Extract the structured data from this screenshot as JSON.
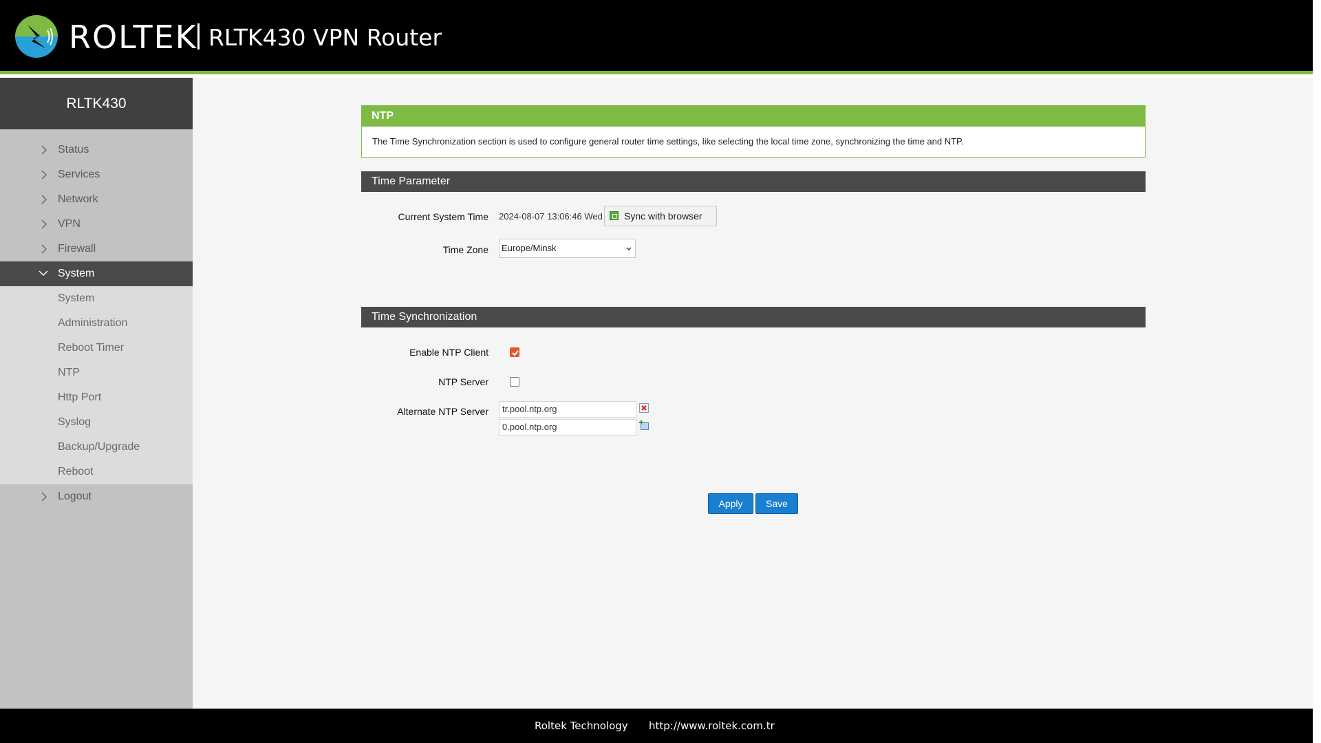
{
  "header": {
    "brand": "ROLTEK",
    "product": "RLTK430 VPN Router"
  },
  "sidebar": {
    "title": "RLTK430",
    "items": [
      {
        "label": "Status"
      },
      {
        "label": "Services"
      },
      {
        "label": "Network"
      },
      {
        "label": "VPN"
      },
      {
        "label": "Firewall"
      },
      {
        "label": "System"
      }
    ],
    "system_sub": [
      {
        "label": "System"
      },
      {
        "label": "Administration"
      },
      {
        "label": "Reboot Timer"
      },
      {
        "label": "NTP"
      },
      {
        "label": "Http Port"
      },
      {
        "label": "Syslog"
      },
      {
        "label": "Backup/Upgrade"
      },
      {
        "label": "Reboot"
      }
    ],
    "logout": "Logout"
  },
  "ntp_panel": {
    "title": "NTP",
    "description": "The Time Synchronization section is used to configure general router time settings, like selecting the local time zone, synchronizing the time and NTP."
  },
  "time_parameter": {
    "title": "Time Parameter",
    "current_time_label": "Current System Time",
    "current_time_value": "2024-08-07 13:06:46 Wed",
    "sync_button": "Sync with browser",
    "timezone_label": "Time Zone",
    "timezone_value": "Europe/Minsk"
  },
  "time_sync": {
    "title": "Time Synchronization",
    "enable_ntp_label": "Enable NTP Client",
    "enable_ntp_checked": true,
    "ntp_server_label": "NTP Server",
    "ntp_server_checked": false,
    "alt_server_label": "Alternate NTP Server",
    "alt_servers": [
      "tr.pool.ntp.org",
      "0.pool.ntp.org"
    ]
  },
  "actions": {
    "apply": "Apply",
    "save": "Save"
  },
  "footer": {
    "company": "Roltek Technology",
    "url": "http://www.roltek.com.tr"
  },
  "colors": {
    "accent_green": "#7dbb44",
    "button_blue": "#1a7fd1",
    "checkbox_orange": "#e4572e"
  }
}
